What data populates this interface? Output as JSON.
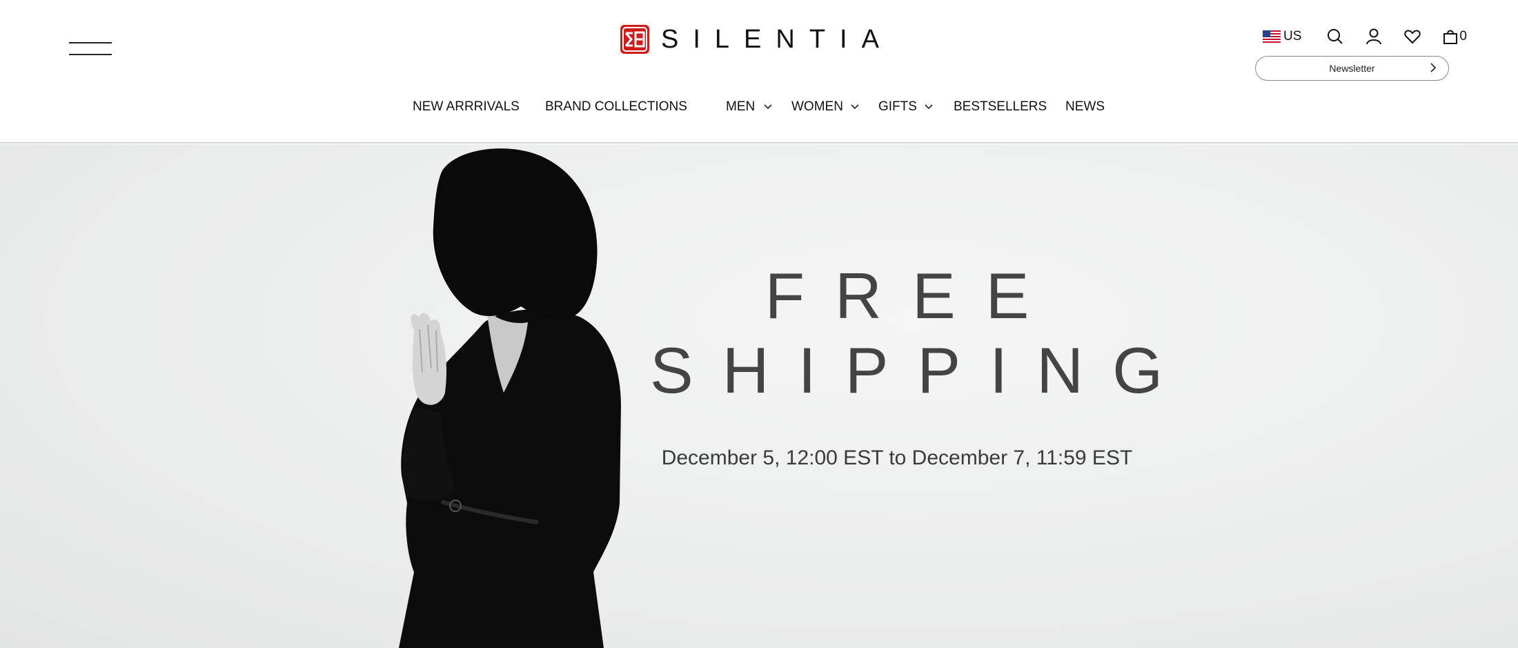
{
  "brand": {
    "name": "SILENTIA",
    "accent_color": "#d01b1b"
  },
  "header": {
    "menu_icon": "hamburger-menu-icon",
    "country_label": "US",
    "icons": [
      "search-icon",
      "account-icon",
      "wishlist-heart-icon",
      "shopping-bag-icon"
    ],
    "cart_count": "0",
    "newsletter_label": "Newsletter"
  },
  "nav": {
    "items": [
      {
        "label": "NEW ARRRIVALS",
        "has_dropdown": false
      },
      {
        "label": "BRAND COLLECTIONS",
        "has_dropdown": true
      },
      {
        "label": "MEN",
        "has_dropdown": true
      },
      {
        "label": "WOMEN",
        "has_dropdown": true
      },
      {
        "label": "GIFTS",
        "has_dropdown": true
      },
      {
        "label": "BESTSELLERS",
        "has_dropdown": false
      },
      {
        "label": "NEWS",
        "has_dropdown": false
      }
    ]
  },
  "hero": {
    "title_line1": "FREE",
    "title_line2": "SHIPPING",
    "subtitle": "December 5, 12:00 EST to December 7, 11:59 EST"
  }
}
